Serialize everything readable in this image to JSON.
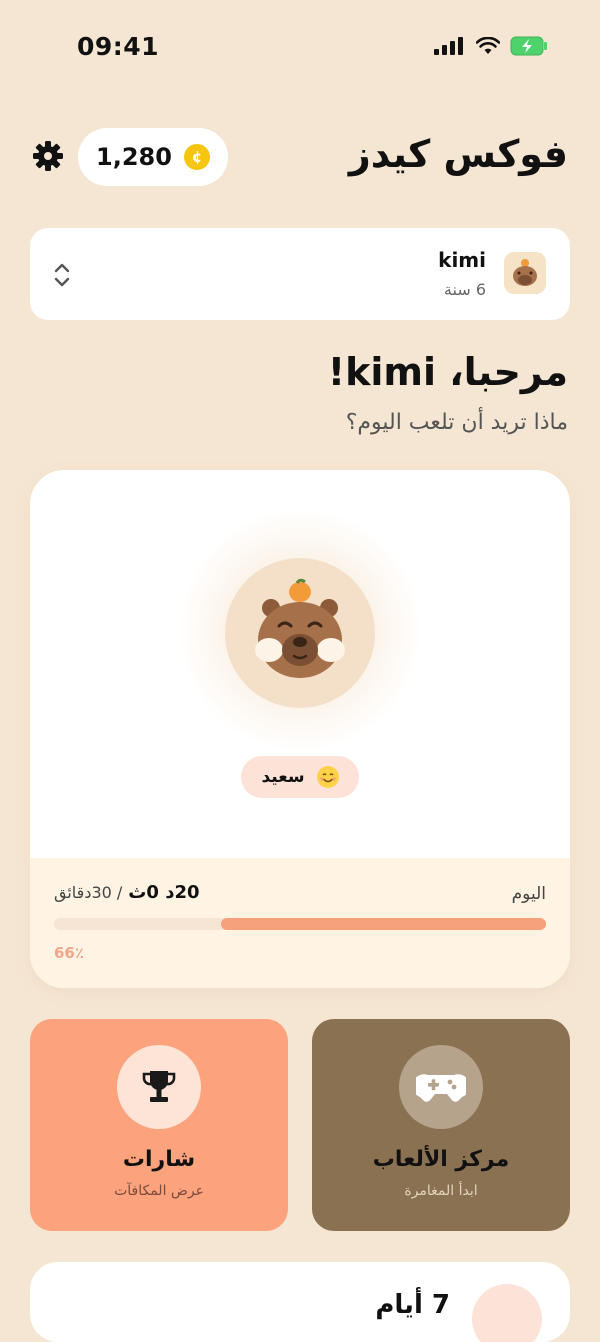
{
  "status_bar": {
    "time": "09:41"
  },
  "header": {
    "title": "فوكس كيدز",
    "coins": "1,280",
    "coin_symbol": "¢"
  },
  "profile": {
    "name": "kimi",
    "age": "6 سنة"
  },
  "greeting": {
    "title": "مرحبا، kimi!",
    "subtitle": "ماذا تريد أن تلعب اليوم؟"
  },
  "pet": {
    "mood_label": "سعيد",
    "mood_icon": "smile-emoji-icon"
  },
  "screen_time": {
    "today_label": "اليوم",
    "used": "20د 0ث",
    "limit": "/ 30دقائق",
    "percent_label": "66٪",
    "progress": 0.66
  },
  "tiles": {
    "badges": {
      "title": "شارات",
      "subtitle": "عرض المكافآت",
      "icon": "trophy-icon"
    },
    "games": {
      "title": "مركز الألعاب",
      "subtitle": "ابدأ المغامرة",
      "icon": "gamepad-icon"
    }
  },
  "streak": {
    "text": "7 أيام"
  },
  "colors": {
    "background": "#f5e6d3",
    "accent": "#fca27d",
    "games_tile": "#8a7151",
    "progress_fill": "#f7a07c",
    "coin": "#f6c510"
  }
}
